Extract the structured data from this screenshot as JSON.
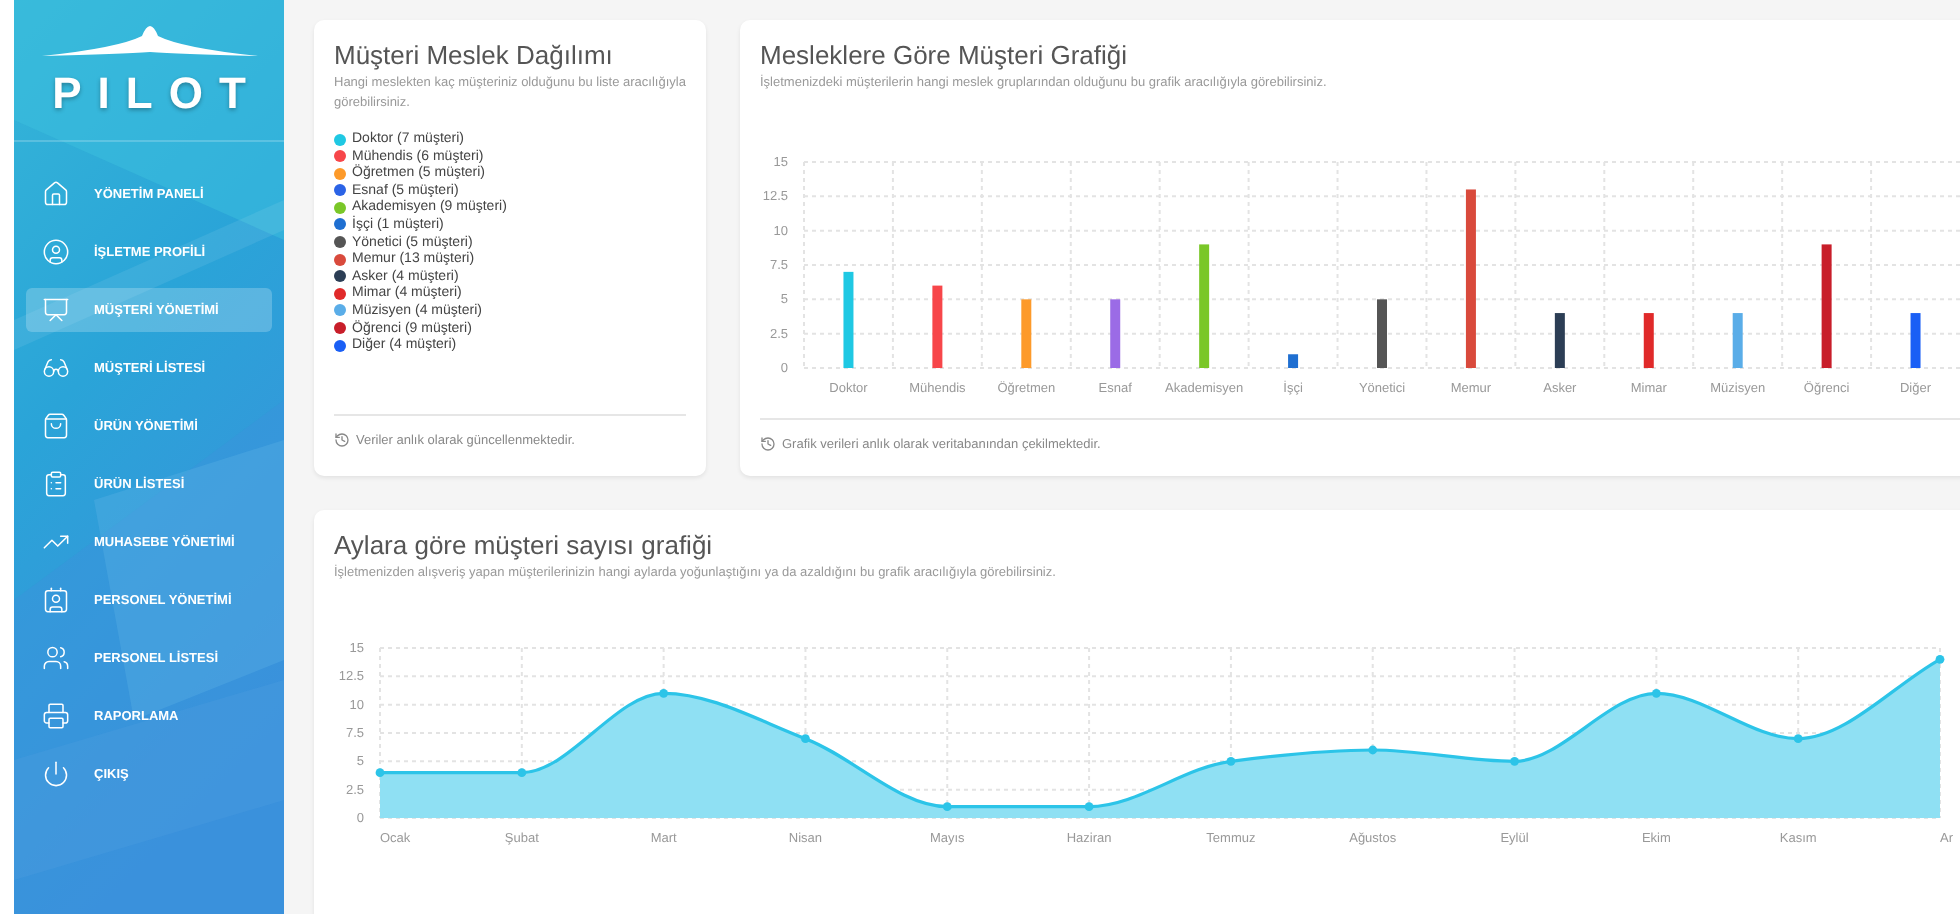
{
  "sidebar": {
    "logo": "PILOT",
    "items": [
      {
        "label": "YÖNETİM PANELİ",
        "selected": false
      },
      {
        "label": "İŞLETME PROFİLİ",
        "selected": false
      },
      {
        "label": "MÜŞTERİ YÖNETİMİ",
        "selected": true
      },
      {
        "label": "MÜŞTERİ LİSTESİ",
        "selected": false
      },
      {
        "label": "ÜRÜN YÖNETİMİ",
        "selected": false
      },
      {
        "label": "ÜRÜN LİSTESİ",
        "selected": false
      },
      {
        "label": "MUHASEBE YÖNETİMİ",
        "selected": false
      },
      {
        "label": "PERSONEL YÖNETİMİ",
        "selected": false
      },
      {
        "label": "PERSONEL LİSTESİ",
        "selected": false
      },
      {
        "label": "RAPORLAMA",
        "selected": false
      },
      {
        "label": "ÇIKIŞ",
        "selected": false
      }
    ]
  },
  "distribution_card": {
    "title": "Müşteri Meslek Dağılımı",
    "subtitle": "Hangi meslekten kaç müşteriniz olduğunu bu liste aracılığıyla görebilirsiniz.",
    "items": [
      {
        "label": "Doktor (7 müşteri)",
        "color": "#1fc8e3"
      },
      {
        "label": "Mühendis (6 müşteri)",
        "color": "#f7464a"
      },
      {
        "label": "Öğretmen (5 müşteri)",
        "color": "#fd9a2a"
      },
      {
        "label": "Esnaf (5 müşteri)",
        "color": "#2b63e6"
      },
      {
        "label": "Akademisyen (9 müşteri)",
        "color": "#7ac728"
      },
      {
        "label": "İşçi (1 müşteri)",
        "color": "#1f6fd1"
      },
      {
        "label": "Yönetici (5 müşteri)",
        "color": "#555555"
      },
      {
        "label": "Memur (13 müşteri)",
        "color": "#d94a3c"
      },
      {
        "label": "Asker (4 müşteri)",
        "color": "#2c3e55"
      },
      {
        "label": "Mimar (4 müşteri)",
        "color": "#e02a2a"
      },
      {
        "label": "Müzisyen (4 müşteri)",
        "color": "#5aade8"
      },
      {
        "label": "Öğrenci (9 müşteri)",
        "color": "#c81e2a"
      },
      {
        "label": "Diğer (4 müşteri)",
        "color": "#1a5ff5"
      }
    ],
    "footer": "Veriler anlık olarak güncellenmektedir."
  },
  "bar_card": {
    "title": "Mesleklere Göre Müşteri Grafiği",
    "subtitle": "İşletmenizdeki müşterilerin hangi meslek gruplarından olduğunu bu grafik aracılığıyla görebilirsiniz.",
    "chart_data": {
      "type": "bar",
      "categories": [
        "Doktor",
        "Mühendis",
        "Öğretmen",
        "Esnaf",
        "Akademisyen",
        "İşçi",
        "Yönetici",
        "Memur",
        "Asker",
        "Mimar",
        "Müzisyen",
        "Öğrenci",
        "Diğer"
      ],
      "grid": true,
      "series": [
        {
          "values": [
            7,
            6,
            5,
            5,
            9,
            1,
            5,
            13,
            4,
            4,
            4,
            9,
            4
          ]
        }
      ],
      "colors": [
        "#1fc8e3",
        "#f7464a",
        "#fd9a2a",
        "#9b6be6",
        "#7ac728",
        "#1f6fd1",
        "#555555",
        "#d94a3c",
        "#2c3e55",
        "#e02a2a",
        "#5aade8",
        "#c81e2a",
        "#1a5ff5"
      ],
      "ylim": [
        0,
        15
      ],
      "yticks": [
        0,
        2.5,
        5,
        7.5,
        10,
        12.5,
        15
      ]
    },
    "footer": "Grafik verileri anlık olarak veritabanından çekilmektedir."
  },
  "line_card": {
    "title": "Aylara göre müşteri sayısı grafiği",
    "subtitle": "İşletmenizden alışveriş yapan müşterilerinizin hangi aylarda yoğunlaştığını ya da azaldığını bu grafik aracılığıyla görebilirsiniz.",
    "chart_data": {
      "type": "area",
      "categories": [
        "Ocak",
        "Şubat",
        "Mart",
        "Nisan",
        "Mayıs",
        "Haziran",
        "Temmuz",
        "Ağustos",
        "Eylül",
        "Ekim",
        "Kasım",
        "Ar"
      ],
      "grid": true,
      "series": [
        {
          "color": "#2cc4e8",
          "values": [
            4,
            4,
            11,
            7,
            1,
            1,
            5,
            6,
            5,
            11,
            7,
            14
          ]
        }
      ],
      "ylim": [
        0,
        15
      ],
      "yticks": [
        0,
        2.5,
        5,
        7.5,
        10,
        12.5,
        15
      ]
    }
  }
}
